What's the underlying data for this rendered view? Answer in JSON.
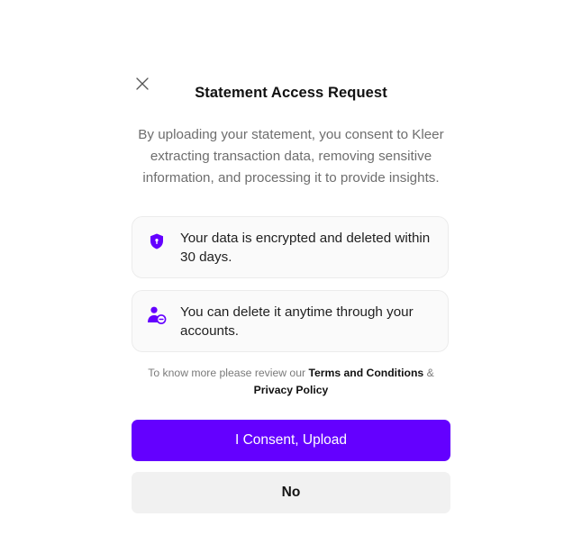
{
  "dialog": {
    "title": "Statement Access Request",
    "description": "By uploading your statement, you consent to Kleer extracting transaction data, removing sensitive information, and processing it to provide insights.",
    "close_icon": "close-icon"
  },
  "cards": [
    {
      "icon": "shield-lock-icon",
      "text": "Your data is encrypted and deleted within 30 days."
    },
    {
      "icon": "user-remove-icon",
      "text": "You can delete it anytime through your accounts."
    }
  ],
  "legal": {
    "prefix": "To know more please review our",
    "terms": "Terms and Conditions",
    "separator": "&",
    "privacy": "Privacy Policy"
  },
  "actions": {
    "consent_label": "I Consent, Upload",
    "decline_label": "No"
  },
  "colors": {
    "accent": "#6400ff",
    "secondary_button": "#f1f1f1",
    "card_background": "#fafafa",
    "muted_text": "#6e6e6e"
  }
}
